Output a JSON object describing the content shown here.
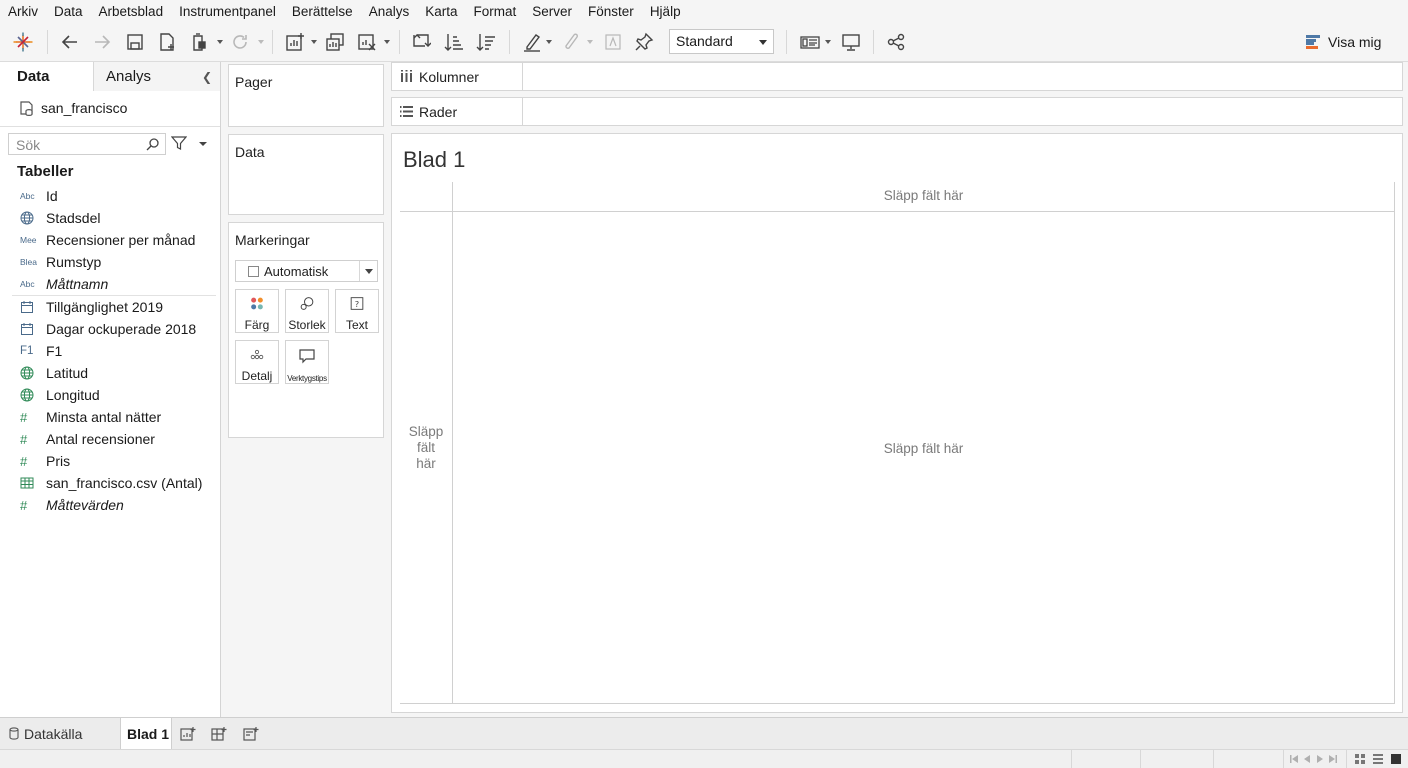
{
  "menu": [
    "Arkiv",
    "Data",
    "Arbetsblad",
    "Instrumentpanel",
    "Berättelse",
    "Analys",
    "Karta",
    "Format",
    "Server",
    "Fönster",
    "Hjälp"
  ],
  "toolbar": {
    "fit_value": "Standard",
    "show_me_label": "Visa mig"
  },
  "data_pane": {
    "tab_data": "Data",
    "tab_analytics": "Analys",
    "datasource": "san_francisco",
    "search_placeholder": "Sök",
    "tables_heading": "Tabeller",
    "dimensions": [
      {
        "type": "Abc",
        "name": "Id"
      },
      {
        "type": "globe",
        "name": "Stadsdel"
      },
      {
        "type": "Mee",
        "name": "Recensioner per månad"
      },
      {
        "type": "Blea",
        "name": "Rumstyp"
      },
      {
        "type": "Abc",
        "name": "Måttnamn"
      }
    ],
    "measures": [
      {
        "type": "calendar",
        "name": "Tillgänglighet 2019"
      },
      {
        "type": "calendar",
        "name": "Dagar ockuperade 2018"
      },
      {
        "type": "F1",
        "name": "F1"
      },
      {
        "type": "globe",
        "name": "Latitud"
      },
      {
        "type": "globe",
        "name": "Longitud"
      },
      {
        "type": "#",
        "name": "Minsta antal nätter"
      },
      {
        "type": "#",
        "name": "Antal recensioner"
      },
      {
        "type": "#",
        "name": "Pris"
      },
      {
        "type": "table",
        "name": "san_francisco.csv (Antal)"
      },
      {
        "type": "#",
        "name": "Måttevärden"
      }
    ]
  },
  "shelves": {
    "pages": "Pager",
    "filters": "Data",
    "marks": "Markeringar",
    "mark_type": "Automatisk",
    "mark_buttons": [
      "Färg",
      "Storlek",
      "Text",
      "Detalj",
      "Verktygstips"
    ],
    "columns": "Kolumner",
    "rows": "Rader"
  },
  "view": {
    "sheet_title": "Blad 1",
    "drop_top": "Släpp fält här",
    "drop_left_lines": [
      "Släpp",
      "fält",
      "här"
    ],
    "drop_center": "Släpp fält här"
  },
  "sheet_tabs": {
    "datasource": "Datakälla",
    "active_sheet": "Blad 1"
  },
  "colors": {
    "accent_orange": "#e96c2f",
    "accent_blue": "#4e79a7",
    "shelf_bg": "#f5f5f5"
  }
}
